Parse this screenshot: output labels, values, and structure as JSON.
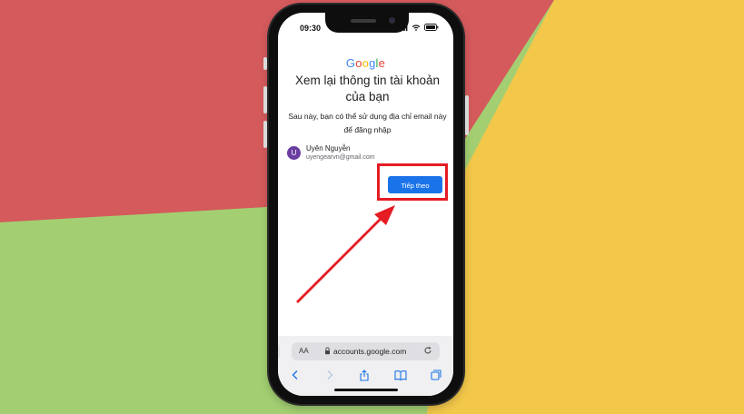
{
  "status_bar": {
    "time": "09:30"
  },
  "google_logo": {
    "letters": [
      {
        "char": "G",
        "color": "#4285F4"
      },
      {
        "char": "o",
        "color": "#EA4335"
      },
      {
        "char": "o",
        "color": "#FBBC05"
      },
      {
        "char": "g",
        "color": "#4285F4"
      },
      {
        "char": "l",
        "color": "#34A853"
      },
      {
        "char": "e",
        "color": "#EA4335"
      }
    ]
  },
  "page": {
    "title": "Xem lại thông tin tài khoản của bạn",
    "subtitle": "Sau này, bạn có thể sử dụng địa chỉ email này để đăng nhập"
  },
  "account": {
    "initial": "U",
    "name": "Uyên Nguyễn",
    "email": "uyengearvn@gmail.com",
    "avatar_color": "#6a3ea1"
  },
  "next_button": {
    "label": "Tiếp theo",
    "color": "#1a73e8"
  },
  "browser": {
    "text_size_label": "AA",
    "url": "accounts.google.com"
  },
  "annotation": {
    "highlight_color": "#e51c23"
  },
  "icons": [
    "signal-icon",
    "wifi-icon",
    "battery-icon",
    "lock-icon",
    "reload-icon",
    "back-icon",
    "forward-icon",
    "share-icon",
    "bookmarks-icon",
    "tabs-icon"
  ]
}
